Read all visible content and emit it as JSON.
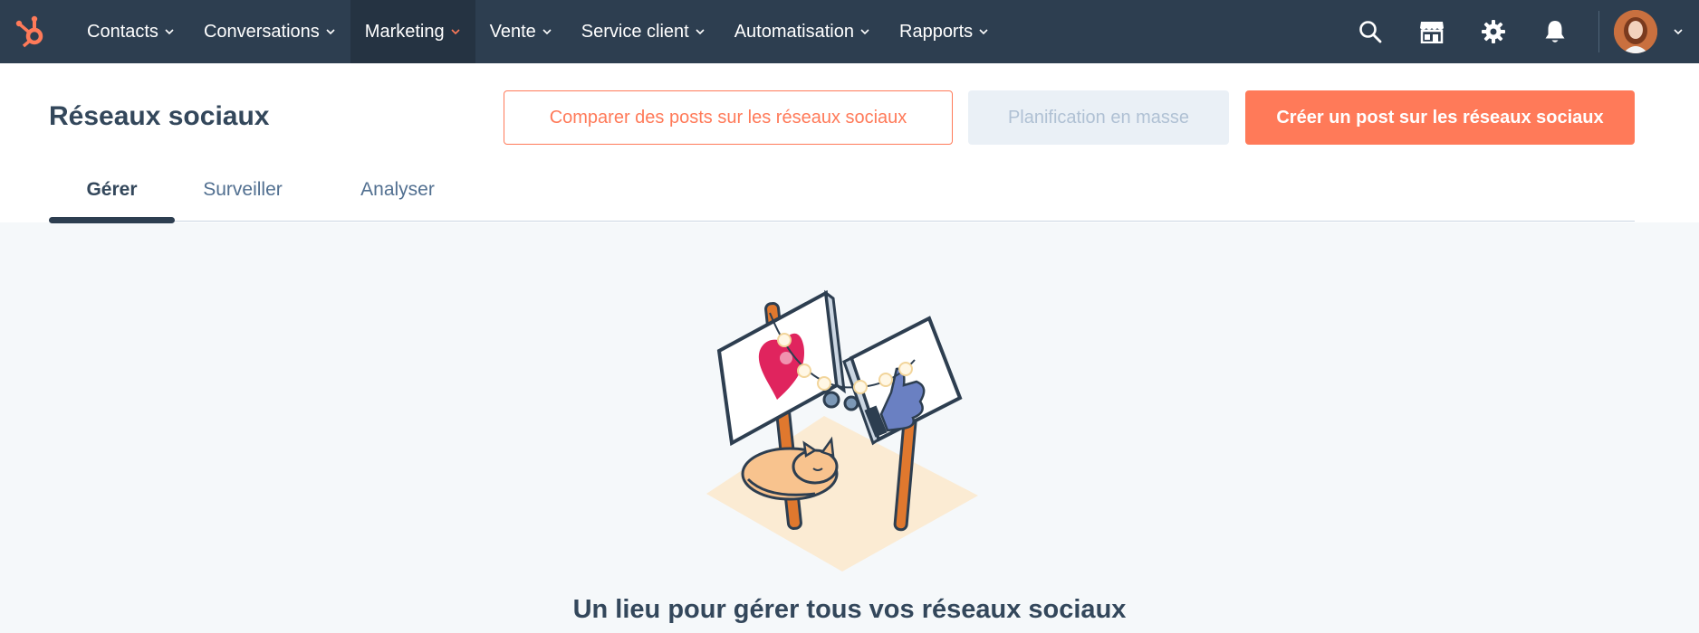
{
  "nav": {
    "items": [
      {
        "label": "Contacts",
        "active": false
      },
      {
        "label": "Conversations",
        "active": false
      },
      {
        "label": "Marketing",
        "active": true
      },
      {
        "label": "Vente",
        "active": false
      },
      {
        "label": "Service client",
        "active": false
      },
      {
        "label": "Automatisation",
        "active": false
      },
      {
        "label": "Rapports",
        "active": false
      }
    ],
    "icons": [
      "search-icon",
      "marketplace-icon",
      "gear-icon",
      "bell-icon"
    ],
    "colors": {
      "bar": "#2d3e50",
      "active": "#253342",
      "accent": "#ff7a59"
    }
  },
  "header": {
    "title": "Réseaux sociaux",
    "buttons": {
      "compare": "Comparer des posts sur les réseaux sociaux",
      "bulk": "Planification en masse",
      "create": "Créer un post sur les réseaux sociaux"
    },
    "tabs": [
      {
        "label": "Gérer",
        "active": true
      },
      {
        "label": "Surveiller",
        "active": false
      },
      {
        "label": "Analyser",
        "active": false
      }
    ]
  },
  "main": {
    "heading": "Un lieu pour gérer tous vos réseaux sociaux"
  }
}
